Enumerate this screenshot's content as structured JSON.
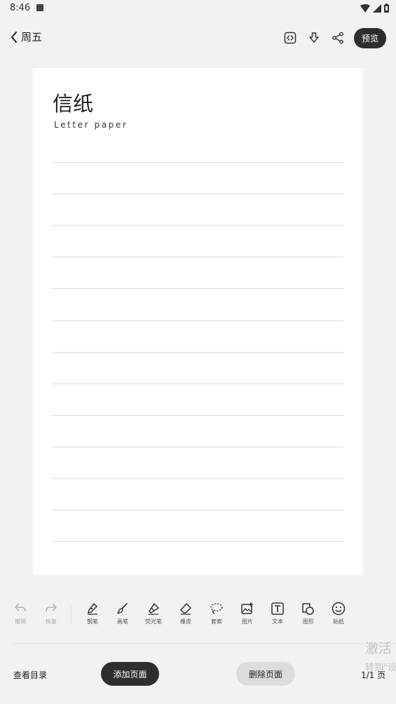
{
  "status": {
    "time": "8:46"
  },
  "header": {
    "back_title": "周五",
    "preview_label": "预览"
  },
  "paper": {
    "title": "信纸",
    "subtitle": "Letter paper",
    "line_count": 13
  },
  "toolbar": {
    "items": [
      {
        "label": "撤销",
        "icon": "undo-icon",
        "enabled": false
      },
      {
        "label": "恢复",
        "icon": "redo-icon",
        "enabled": false
      },
      {
        "label": "钢笔",
        "icon": "pen-icon",
        "enabled": true
      },
      {
        "label": "画笔",
        "icon": "brush-icon",
        "enabled": true
      },
      {
        "label": "荧光笔",
        "icon": "highlighter-icon",
        "enabled": true
      },
      {
        "label": "橡皮",
        "icon": "eraser-icon",
        "enabled": true
      },
      {
        "label": "套索",
        "icon": "lasso-icon",
        "enabled": true
      },
      {
        "label": "图片",
        "icon": "image-add-icon",
        "enabled": true
      },
      {
        "label": "文本",
        "icon": "text-box-icon",
        "enabled": true
      },
      {
        "label": "图形",
        "icon": "shapes-icon",
        "enabled": true
      },
      {
        "label": "贴纸",
        "icon": "sticker-icon",
        "enabled": true
      }
    ]
  },
  "bottom": {
    "catalog_label": "查看目录",
    "add_page_label": "添加页面",
    "delete_page_label": "删除页面",
    "page_count": "1/1 页"
  },
  "watermark": {
    "line1": "激活",
    "line2": "转到\"设"
  }
}
